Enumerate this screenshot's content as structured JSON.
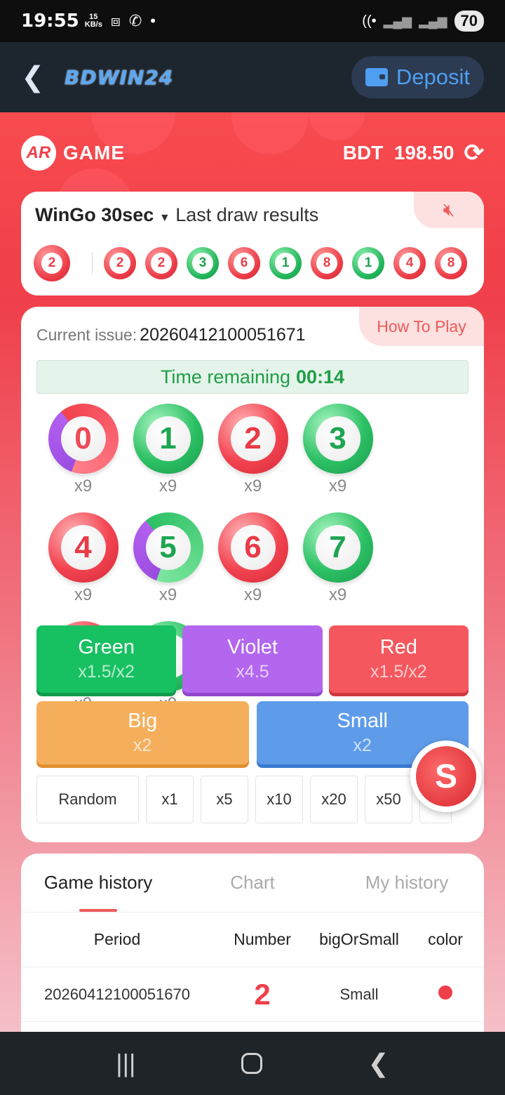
{
  "status": {
    "time": "19:55",
    "speed_num": "15",
    "speed_unit": "KB/s",
    "battery": "70"
  },
  "topbar": {
    "logo": "BDWIN24",
    "deposit_label": "Deposit"
  },
  "game": {
    "brand": "GAME",
    "brand_mark": "AR",
    "balance": "BDT  198.50"
  },
  "draw": {
    "title": "WinGo 30sec",
    "subtitle": "Last draw results",
    "latest": "2",
    "results": [
      {
        "n": "2",
        "c": "r"
      },
      {
        "n": "2",
        "c": "r"
      },
      {
        "n": "3",
        "c": "g"
      },
      {
        "n": "6",
        "c": "r"
      },
      {
        "n": "1",
        "c": "g"
      },
      {
        "n": "8",
        "c": "r"
      },
      {
        "n": "1",
        "c": "g"
      },
      {
        "n": "4",
        "c": "r"
      },
      {
        "n": "8",
        "c": "r"
      }
    ]
  },
  "bet": {
    "how_to_play": "How To Play",
    "issue_label": "Current issue:",
    "issue_number": "20260412100051671",
    "time_label": "Time remaining",
    "time_value": "00:14",
    "numbers": [
      {
        "n": "0",
        "c": "rv",
        "mult": "x9"
      },
      {
        "n": "1",
        "c": "g",
        "mult": "x9"
      },
      {
        "n": "2",
        "c": "r",
        "mult": "x9"
      },
      {
        "n": "3",
        "c": "g",
        "mult": "x9"
      },
      {
        "n": "4",
        "c": "r",
        "mult": "x9"
      },
      {
        "n": "5",
        "c": "gv",
        "mult": "x9"
      },
      {
        "n": "6",
        "c": "r",
        "mult": "x9"
      },
      {
        "n": "7",
        "c": "g",
        "mult": "x9"
      },
      {
        "n": "8",
        "c": "r",
        "mult": "x9"
      },
      {
        "n": "9",
        "c": "g",
        "mult": "x9"
      }
    ],
    "green": {
      "label": "Green",
      "mult": "x1.5/x2"
    },
    "violet": {
      "label": "Violet",
      "mult": "x4.5"
    },
    "red": {
      "label": "Red",
      "mult": "x1.5/x2"
    },
    "big": {
      "label": "Big",
      "mult": "x2"
    },
    "small": {
      "label": "Small",
      "mult": "x2"
    },
    "multipliers": [
      "Random",
      "x1",
      "x5",
      "x10",
      "x20",
      "x50"
    ]
  },
  "history": {
    "tabs": [
      "Game history",
      "Chart",
      "My history"
    ],
    "columns": [
      "Period",
      "Number",
      "bigOrSmall",
      "color"
    ],
    "rows": [
      {
        "period": "20260412100051670",
        "number": "2",
        "size": "Small",
        "color": "#ef3f4a"
      }
    ]
  },
  "colors": {
    "red": "#ef3f4a",
    "green": "#1ea551",
    "violet": "#b366ee",
    "accent": "#4f9ef2"
  }
}
